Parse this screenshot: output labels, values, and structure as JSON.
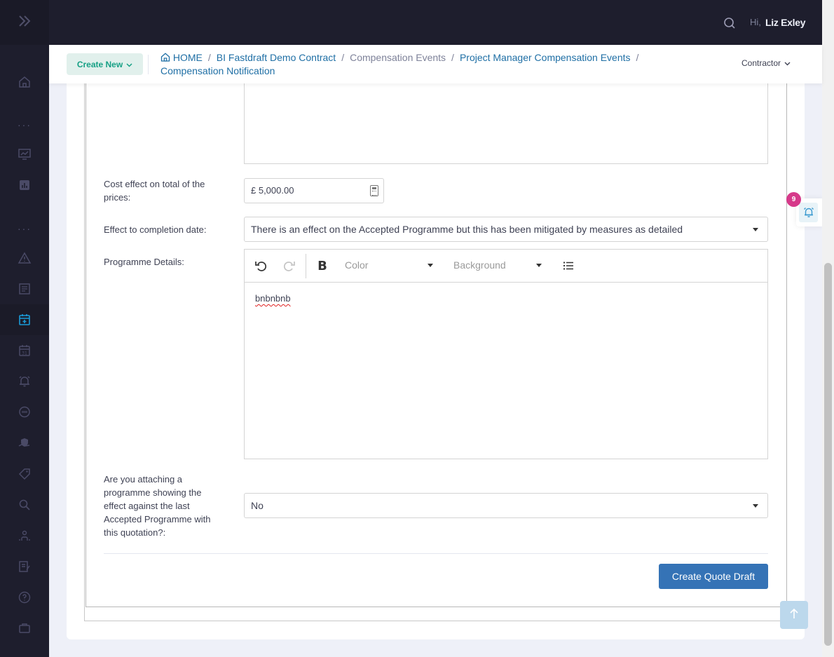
{
  "header": {
    "greeting": "Hi,",
    "user_name": "Liz Exley"
  },
  "subheader": {
    "create_new_label": "Create New",
    "breadcrumb": [
      {
        "label": "HOME"
      },
      {
        "label": "BI Fastdraft Demo Contract"
      },
      {
        "label": "Compensation Events"
      },
      {
        "label": "Project Manager Compensation Events"
      },
      {
        "label": "Compensation Notification"
      }
    ],
    "role_label": "Contractor"
  },
  "form": {
    "cost_effect_label": "Cost effect on total of the prices:",
    "cost_effect_value": "£ 5,000.00",
    "completion_date_label": "Effect to completion date:",
    "completion_date_value": "There is an effect on the Accepted Programme but this has been mitigated by measures as detailed",
    "programme_details_label": "Programme Details:",
    "editor": {
      "color_placeholder": "Color",
      "background_placeholder": "Background",
      "content": "bnbnbnb"
    },
    "attaching_label": "Are you attaching a programme showing the effect against the last Accepted Programme with this quotation?:",
    "attaching_value": "No",
    "submit_label": "Create Quote Draft"
  },
  "notifications": {
    "count": "9"
  },
  "colors": {
    "sidebar_bg": "#1e1e2d",
    "accent_teal": "#1bc5bd",
    "primary_button": "#3573b6",
    "link_blue": "#1f6fa5",
    "badge_pink": "#d6398a"
  }
}
